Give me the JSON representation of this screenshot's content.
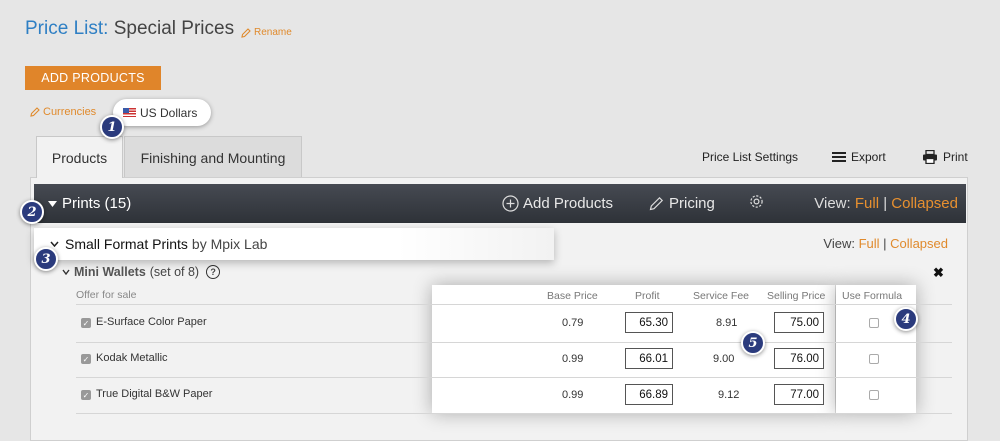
{
  "header": {
    "title_prefix": "Price List:",
    "title_name": "Special Prices",
    "rename": "Rename"
  },
  "add_products_button": "ADD PRODUCTS",
  "currencies": {
    "link": "Currencies",
    "selected": "US Dollars"
  },
  "badges": [
    "1",
    "2",
    "3",
    "4",
    "5"
  ],
  "tabs": [
    {
      "label": "Products",
      "active": true
    },
    {
      "label": "Finishing and Mounting",
      "active": false
    }
  ],
  "toolbar": {
    "settings": "Price List Settings",
    "export": "Export",
    "print": "Print"
  },
  "category_bar": {
    "title": "Prints (15)",
    "add_products": "Add Products",
    "pricing": "Pricing",
    "view_label": "View:",
    "view_full": "Full",
    "view_sep": "|",
    "view_collapsed": "Collapsed"
  },
  "subcategory": {
    "name": "Small Format Prints",
    "by": "by Mpix Lab",
    "view_label": "View:",
    "view_full": "Full",
    "view_sep": "|",
    "view_collapsed": "Collapsed"
  },
  "product": {
    "name": "Mini Wallets",
    "set": "(set of 8)",
    "help": "?",
    "close": "✖"
  },
  "offer_for_sale": "Offer for sale",
  "columns": {
    "base_price": "Base Price",
    "profit": "Profit",
    "service_fee": "Service Fee",
    "selling_price": "Selling Price",
    "use_formula": "Use Formula"
  },
  "rows": [
    {
      "name": "E-Surface Color Paper",
      "base": "0.79",
      "profit": "65.30",
      "fee": "8.91",
      "selling": "75.00"
    },
    {
      "name": "Kodak Metallic",
      "base": "0.99",
      "profit": "66.01",
      "fee": "9.00",
      "selling": "76.00"
    },
    {
      "name": "True Digital B&W Paper",
      "base": "0.99",
      "profit": "66.89",
      "fee": "9.12",
      "selling": "77.00"
    }
  ],
  "colors": {
    "accent_orange": "#e0852a",
    "title_blue": "#2e7fc4",
    "badge_navy": "#2b3b7d",
    "dark_bar": "#3a3e45"
  }
}
